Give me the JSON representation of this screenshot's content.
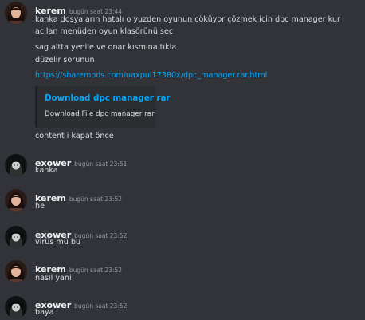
{
  "messages": [
    {
      "author": "kerem",
      "time": "bugün saat 23:44",
      "avatar": "kerem-avatar",
      "lines": [
        "kanka dosyaların hatalı o yuzden oyunun cöküyor çözmek icin dpc manager kur",
        "acılan menüden oyun klasörünü sec",
        "sag altta yenile ve onar kısmına tıkla",
        "düzelir sorunun"
      ],
      "link": "https://sharemods.com/uaxpul17380x/dpc_manager.rar.html",
      "embed": {
        "title": "Download dpc manager rar",
        "description": "Download File dpc manager rar"
      },
      "after": "content i kapat önce"
    },
    {
      "author": "exower",
      "time": "bugün saat 23:51",
      "avatar": "exower-avatar",
      "text": "kanka"
    },
    {
      "author": "kerem",
      "time": "bugün saat 23:52",
      "avatar": "kerem-avatar",
      "text": "he"
    },
    {
      "author": "exower",
      "time": "bugün saat 23:52",
      "avatar": "exower-avatar",
      "text": "virüs mü bu"
    },
    {
      "author": "kerem",
      "time": "bugün saat 23:52",
      "avatar": "kerem-avatar",
      "text": "nasıl yani"
    },
    {
      "author": "exower",
      "time": "bugün saat 23:52",
      "avatar": "exower-avatar",
      "text": "baya"
    }
  ],
  "colors": {
    "background": "#313338",
    "link": "#00a8fc",
    "embed_bg": "#2b2d31"
  }
}
